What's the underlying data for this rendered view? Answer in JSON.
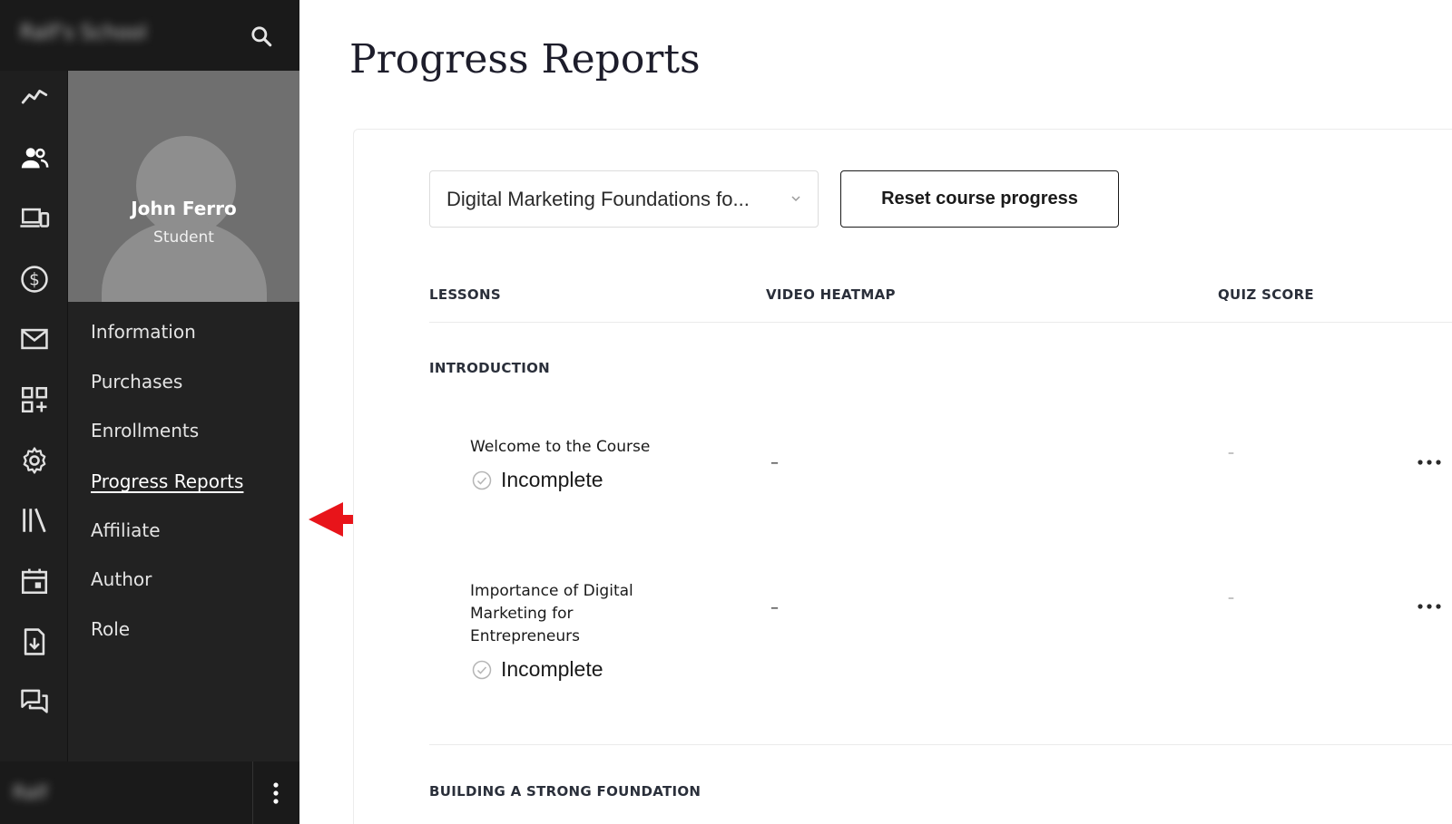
{
  "app": {
    "school_name": "Ralf's School",
    "footer_user": "Ralf"
  },
  "profile": {
    "name": "John Ferro",
    "role": "Student"
  },
  "rail_icons": [
    "analytics-icon",
    "users-icon",
    "devices-icon",
    "dollar-icon",
    "mail-icon",
    "apps-icon",
    "gear-icon",
    "library-icon",
    "calendar-icon",
    "file-download-icon",
    "chat-icon"
  ],
  "nav": {
    "items": [
      {
        "label": "Information"
      },
      {
        "label": "Purchases"
      },
      {
        "label": "Enrollments"
      },
      {
        "label": "Progress Reports"
      },
      {
        "label": "Affiliate"
      },
      {
        "label": "Author"
      },
      {
        "label": "Role"
      }
    ],
    "active": "Progress Reports"
  },
  "page": {
    "title": "Progress Reports"
  },
  "controls": {
    "course_select_value": "Digital Marketing Foundations fo...",
    "reset_label": "Reset course progress"
  },
  "table": {
    "columns": [
      "LESSONS",
      "VIDEO HEATMAP",
      "QUIZ SCORE"
    ],
    "sections": [
      {
        "title": "INTRODUCTION",
        "lessons": [
          {
            "title": "Welcome to the Course",
            "status": "Incomplete",
            "heatmap": "–",
            "quiz": "–"
          },
          {
            "title": "Importance of Digital Marketing for Entrepreneurs",
            "status": "Incomplete",
            "heatmap": "–",
            "quiz": "–"
          }
        ]
      },
      {
        "title": "BUILDING A STRONG FOUNDATION",
        "lessons": []
      }
    ]
  },
  "colors": {
    "sidebar_bg": "#222222",
    "rail_bg": "#1f1f1f",
    "annotation_arrow": "#e8141a"
  }
}
